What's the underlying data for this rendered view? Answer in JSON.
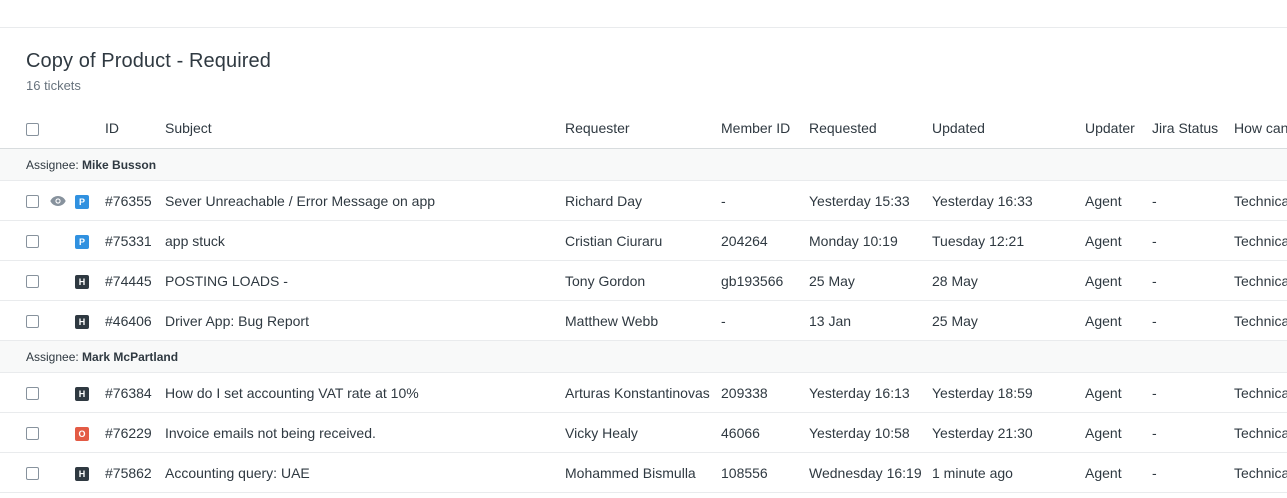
{
  "view": {
    "title": "Copy of Product - Required",
    "count": "16 tickets"
  },
  "columns": {
    "id": "ID",
    "subject": "Subject",
    "requester": "Requester",
    "member_id": "Member ID",
    "requested": "Requested",
    "updated": "Updated",
    "updater": "Updater",
    "jira_status": "Jira Status",
    "how": "How can"
  },
  "groups": [
    {
      "label": "Assignee:",
      "name": "Mike Busson",
      "rows": [
        {
          "status": "P",
          "watching": true,
          "id": "#76355",
          "subject": "Sever Unreachable / Error Message on app",
          "requester": "Richard Day",
          "member_id": "-",
          "requested": "Yesterday 15:33",
          "updated": "Yesterday 16:33",
          "updater": "Agent",
          "jira": "-",
          "how": "Technica"
        },
        {
          "status": "P",
          "watching": false,
          "id": "#75331",
          "subject": "app stuck",
          "requester": "Cristian Ciuraru",
          "member_id": "204264",
          "requested": "Monday 10:19",
          "updated": "Tuesday 12:21",
          "updater": "Agent",
          "jira": "-",
          "how": "Technica"
        },
        {
          "status": "H",
          "watching": false,
          "id": "#74445",
          "subject": "POSTING LOADS -",
          "requester": "Tony Gordon",
          "member_id": "gb193566",
          "requested": "25 May",
          "updated": "28 May",
          "updater": "Agent",
          "jira": "-",
          "how": "Technica"
        },
        {
          "status": "H",
          "watching": false,
          "id": "#46406",
          "subject": "Driver App: Bug Report",
          "requester": "Matthew Webb",
          "member_id": "-",
          "requested": "13 Jan",
          "updated": "25 May",
          "updater": "Agent",
          "jira": "-",
          "how": "Technica"
        }
      ]
    },
    {
      "label": "Assignee:",
      "name": "Mark McPartland",
      "rows": [
        {
          "status": "H",
          "watching": false,
          "id": "#76384",
          "subject": "How do I set accounting VAT rate at 10%",
          "requester": "Arturas Konstantinovas",
          "member_id": "209338",
          "requested": "Yesterday 16:13",
          "updated": "Yesterday 18:59",
          "updater": "Agent",
          "jira": "-",
          "how": "Technica"
        },
        {
          "status": "O",
          "watching": false,
          "id": "#76229",
          "subject": "Invoice emails not being received.",
          "requester": "Vicky Healy",
          "member_id": "46066",
          "requested": "Yesterday 10:58",
          "updated": "Yesterday 21:30",
          "updater": "Agent",
          "jira": "-",
          "how": "Technica"
        },
        {
          "status": "H",
          "watching": false,
          "id": "#75862",
          "subject": "Accounting query: UAE",
          "requester": "Mohammed Bismulla",
          "member_id": "108556",
          "requested": "Wednesday 16:19",
          "updated": "1 minute ago",
          "updater": "Agent",
          "jira": "-",
          "how": "Technica"
        }
      ]
    }
  ]
}
